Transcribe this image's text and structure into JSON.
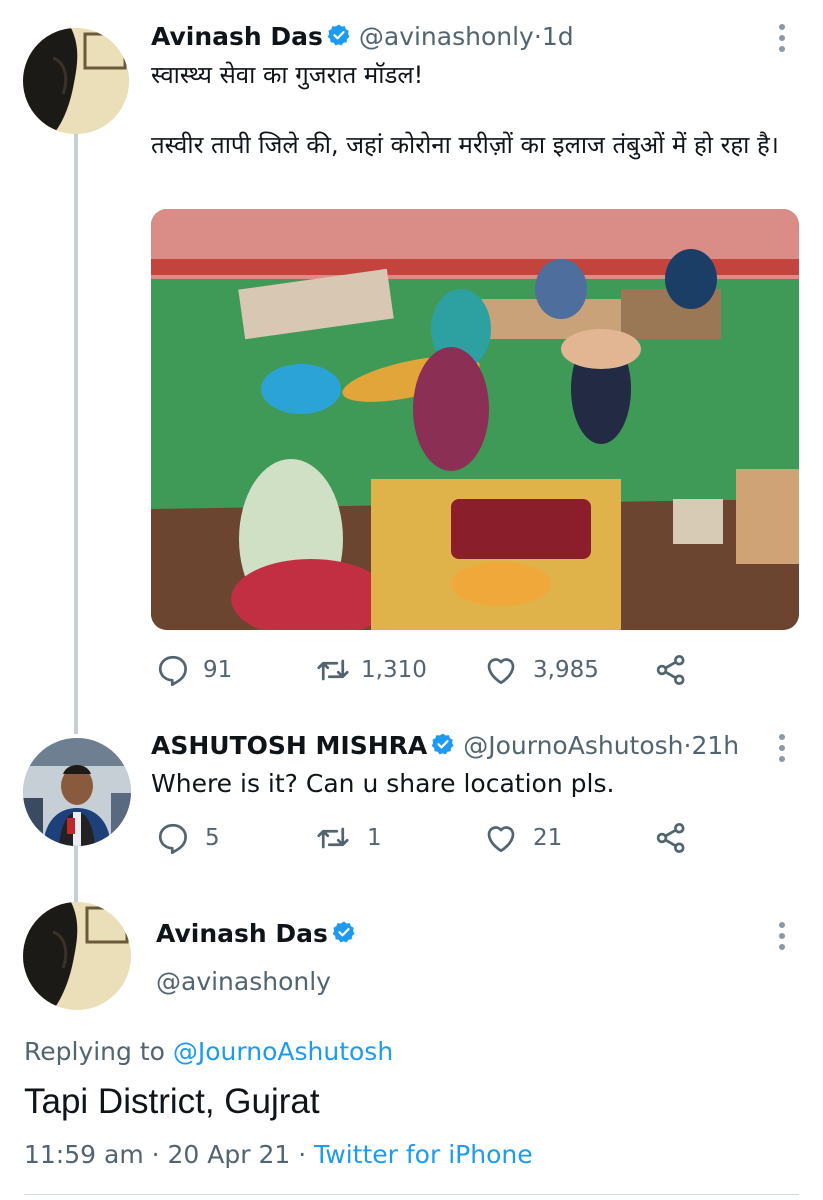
{
  "tweet1": {
    "name": "Avinash Das",
    "handle": "@avinashonly",
    "separator": " · ",
    "time": "1d",
    "line1": "स्वास्थ्य सेवा का गुजरात मॉडल!",
    "line2": "तस्वीर तापी जिले की, जहां कोरोना मरीज़ों का इलाज तंबुओं में हो रहा है।",
    "replies": "91",
    "retweets": "1,310",
    "likes": "3,985"
  },
  "tweet2": {
    "name": "ASHUTOSH MISHRA",
    "handle": "@JournoAshutosh",
    "separator": " · ",
    "time": "21h",
    "text": "Where is it? Can u share location pls.",
    "replies": "5",
    "retweets": "1",
    "likes": "21"
  },
  "tweet3": {
    "name": "Avinash Das",
    "handle": "@avinashonly",
    "replying_prefix": "Replying to ",
    "replying_to": "@JournoAshutosh",
    "text": "Tapi District, Gujrat",
    "time": "11:59 am",
    "date_sep": " · ",
    "date": "20 Apr 21",
    "source_sep": " · ",
    "source": "Twitter for iPhone"
  },
  "colors": {
    "accent": "#1d9bf0",
    "secondary_text": "#536471",
    "thread_line": "#c4cfd6"
  },
  "icons": [
    "verified-badge-icon",
    "reply-icon",
    "retweet-icon",
    "like-icon",
    "share-icon",
    "more-options-icon"
  ]
}
